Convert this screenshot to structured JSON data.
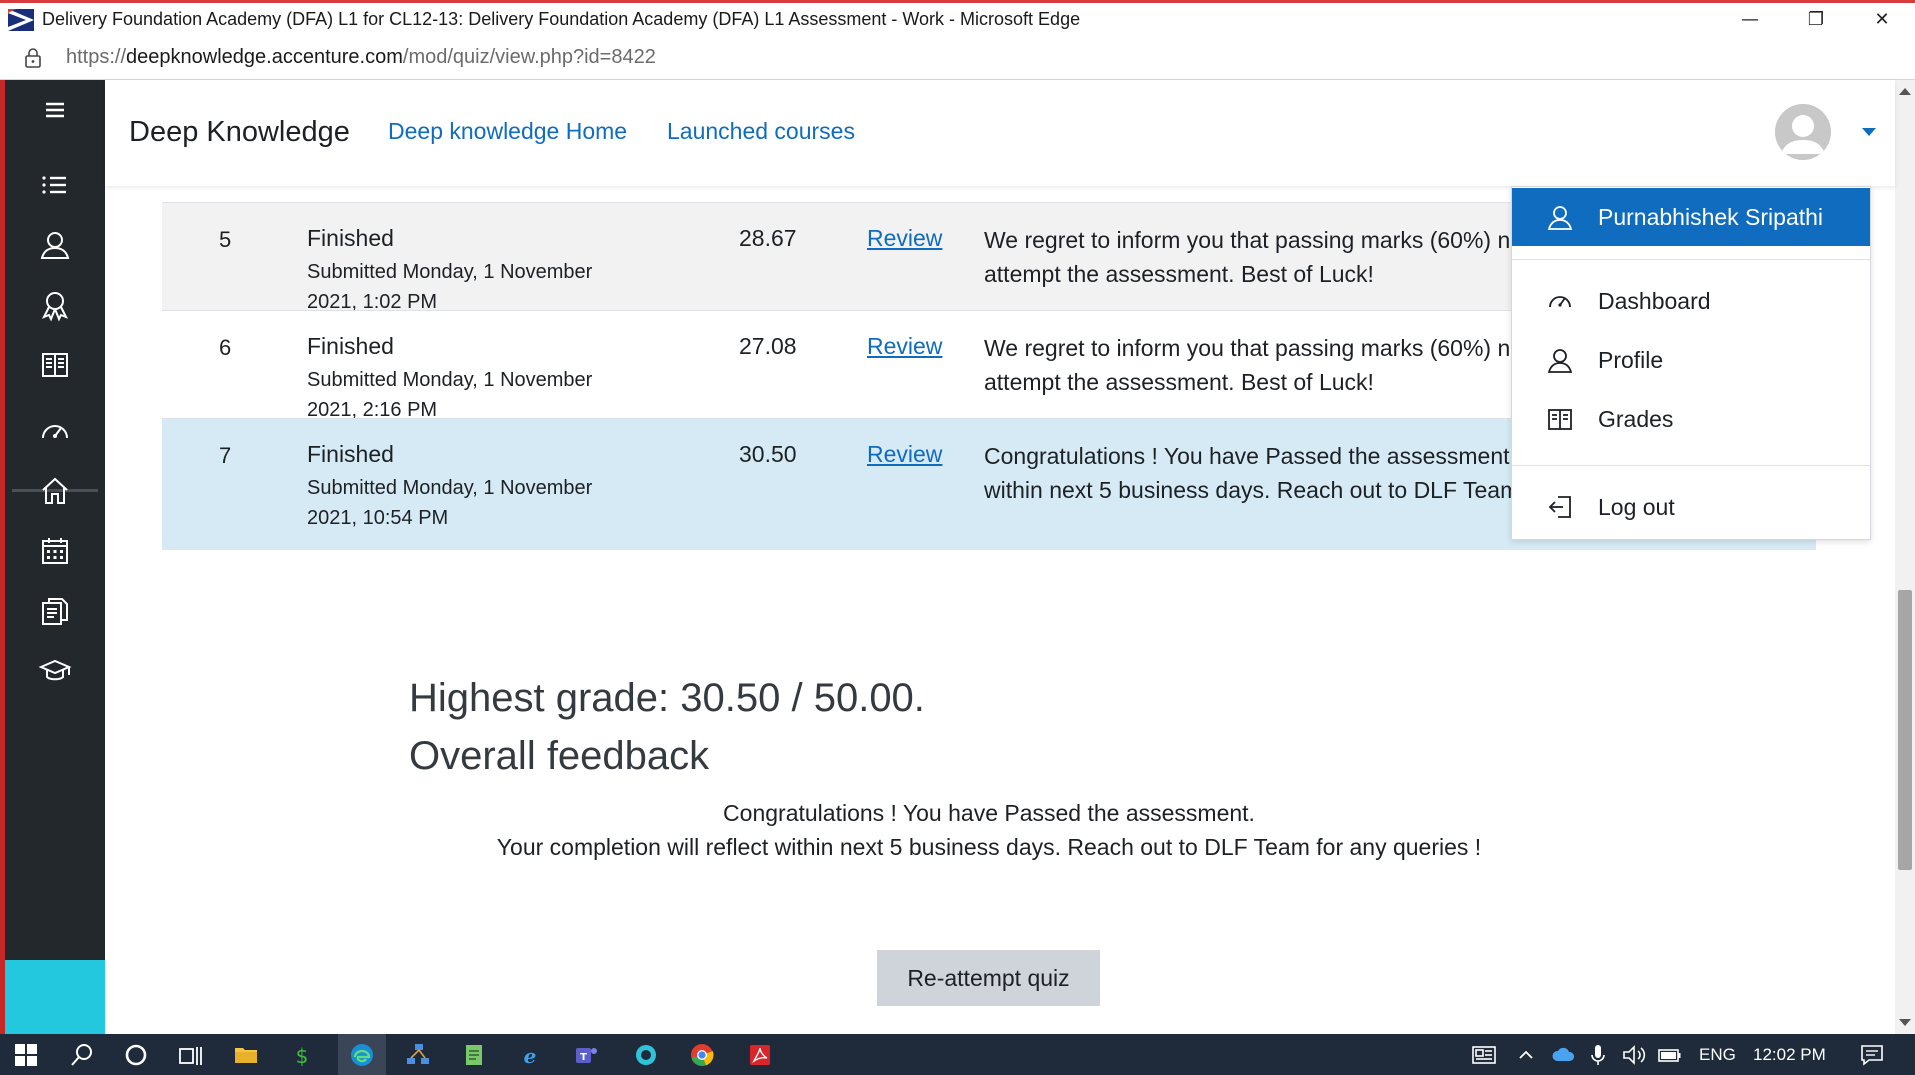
{
  "window": {
    "title": "Delivery Foundation Academy (DFA) L1 for CL12-13: Delivery Foundation Academy (DFA) L1 Assessment - Work - Microsoft Edge",
    "minimize": "—",
    "restore": "❐",
    "close": "✕"
  },
  "address": {
    "prefix": "https://",
    "host": "deepknowledge.accenture.com",
    "path": "/mod/quiz/view.php?id=8422"
  },
  "header": {
    "brand": "Deep Knowledge",
    "links": [
      "Deep knowledge Home",
      "Launched courses"
    ]
  },
  "sidenav": {
    "icons": [
      "menu-icon",
      "list-icon",
      "user-icon",
      "badge-icon",
      "book-icon",
      "dashboard-icon",
      "home-icon",
      "calendar-icon",
      "files-icon",
      "graduation-cap-icon"
    ]
  },
  "attempts": [
    {
      "number": "5",
      "state": "Finished",
      "submitted": "Submitted Monday, 1 November 2021, 1:02 PM",
      "grade": "28.67",
      "review": "Review",
      "feedback": "We regret to inform you that passing marks (60%) not achieved. Please re-attempt the assessment. Best of Luck!"
    },
    {
      "number": "6",
      "state": "Finished",
      "submitted": "Submitted Monday, 1 November 2021, 2:16 PM",
      "grade": "27.08",
      "review": "Review",
      "feedback": "We regret to inform you that passing marks (60%) not achieved. Please re-attempt the assessment. Best of Luck!"
    },
    {
      "number": "7",
      "state": "Finished",
      "submitted": "Submitted Monday, 1 November 2021, 10:54 PM",
      "grade": "30.50",
      "review": "Review",
      "feedback": "Congratulations ! You have Passed the assessment. Your completion will reflect within next 5 business days. Reach out to DLF Team for any queries !"
    }
  ],
  "summary": {
    "highest_grade": "Highest grade: 30.50 / 50.00.",
    "overall_heading": "Overall feedback",
    "line1": "Congratulations ! You have Passed the assessment.",
    "line2": "Your completion will reflect within next 5 business days. Reach out to DLF Team for any queries !",
    "reattempt_label": "Re-attempt quiz"
  },
  "usermenu": {
    "name": "Purnabhishek Sripathi",
    "items": [
      "Dashboard",
      "Profile",
      "Grades"
    ],
    "logout": "Log out"
  },
  "taskbar": {
    "language": "ENG",
    "time": "12:02 PM"
  },
  "colors": {
    "accent": "#0f6cbf",
    "sidenav": "#23282d",
    "highlight_row": "#d6eaf5",
    "cyan": "#24c8de"
  }
}
